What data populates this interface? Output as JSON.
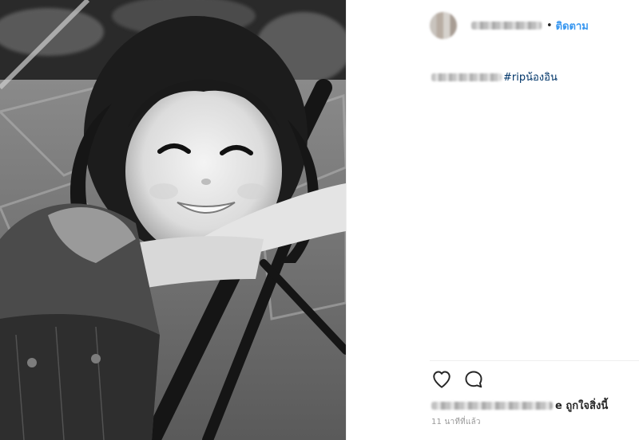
{
  "post": {
    "photo_alt": "black and white photo of smiling young girl with pigtails resting on a chair",
    "header": {
      "separator": "•",
      "follow_label": "ติดตาม"
    },
    "caption": {
      "hashtag": "#ripน้องอิน"
    },
    "actions": {
      "like_icon": "heart-icon",
      "comment_icon": "comment-icon"
    },
    "likes": {
      "suffix": "e ถูกใจสิ่งนี้"
    },
    "timestamp": "11 นาทีที่แล้ว"
  },
  "colors": {
    "link": "#3897f0",
    "hashtag": "#003569",
    "muted": "#999999",
    "text": "#262626"
  }
}
